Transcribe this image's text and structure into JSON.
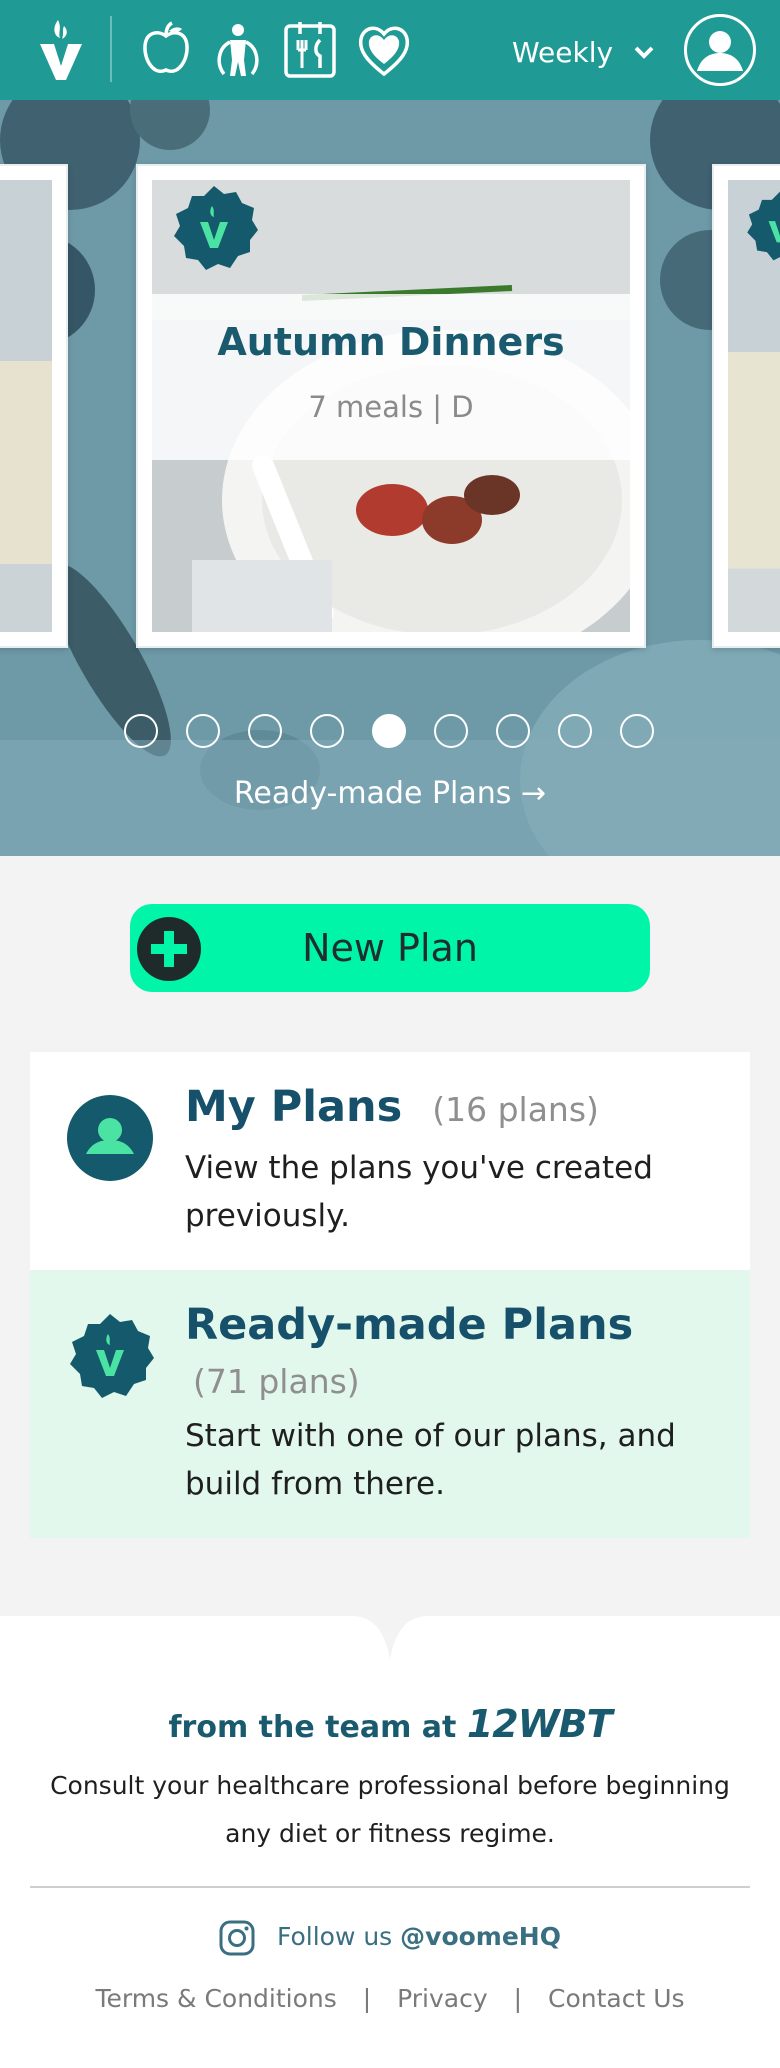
{
  "header": {
    "period_label": "Weekly",
    "nav_icons": [
      "apple-icon",
      "exercise-icon",
      "meal-icon",
      "heart-icon"
    ],
    "brand_color": "#1f9a95"
  },
  "hero": {
    "cards": [
      {
        "title": "Autumn Dinners",
        "subtitle": "7 meals | D"
      }
    ],
    "pagination": {
      "total": 9,
      "active_index": 4
    },
    "link_label": "Ready-made Plans →"
  },
  "new_plan": {
    "label": "New Plan",
    "color": "#00f5a8"
  },
  "panels": {
    "my_plans": {
      "title": "My Plans",
      "count": "(16 plans)",
      "description": "View the plans you've created previously."
    },
    "ready_made": {
      "title": "Ready-made Plans",
      "count": "(71 plans)",
      "description": "Start with one of our plans, and build from there."
    }
  },
  "footer": {
    "team_prefix": "from the team at",
    "team_brand": "12WBT",
    "disclaimer": "Consult your healthcare professional before beginning any diet or fitness regime.",
    "follow_prefix": "Follow us",
    "follow_handle": "@voomeHQ",
    "links": [
      "Terms & Conditions",
      "Privacy",
      "Contact Us"
    ],
    "link_separator": "|"
  }
}
